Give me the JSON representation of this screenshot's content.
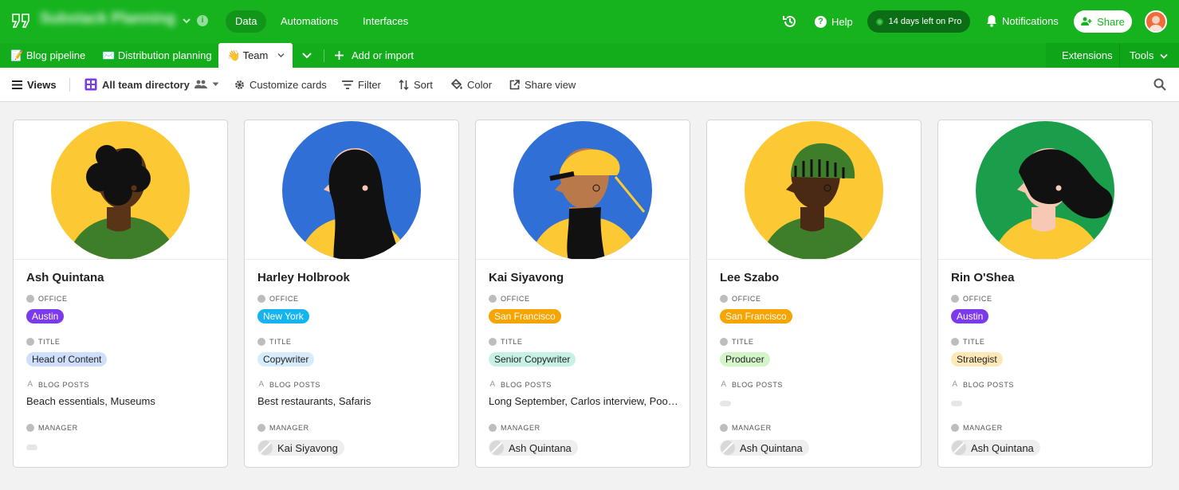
{
  "header": {
    "base_name": "Substack Planning",
    "nav": [
      {
        "label": "Data",
        "active": true
      },
      {
        "label": "Automations",
        "active": false
      },
      {
        "label": "Interfaces",
        "active": false
      }
    ],
    "help_label": "Help",
    "trial_label": "14 days left on Pro",
    "notifications_label": "Notifications",
    "share_label": "Share",
    "colors": {
      "brand": "#16b31f",
      "trial_bg": "#0b6e15"
    }
  },
  "tables": {
    "tabs": [
      {
        "emoji": "📝",
        "label": "Blog pipeline"
      },
      {
        "emoji": "✉️",
        "label": "Distribution planning"
      }
    ],
    "active": {
      "emoji": "👋",
      "label": "Team"
    },
    "add_label": "Add or import",
    "extensions_label": "Extensions",
    "tools_label": "Tools"
  },
  "viewbar": {
    "views_label": "Views",
    "view_name": "All team directory",
    "customize_label": "Customize cards",
    "filter_label": "Filter",
    "sort_label": "Sort",
    "color_label": "Color",
    "share_view_label": "Share view"
  },
  "labels": {
    "office": "OFFICE",
    "title": "TITLE",
    "blog_posts": "BLOG POSTS",
    "manager": "MANAGER"
  },
  "cards": [
    {
      "name": "Ash Quintana",
      "office": "Austin",
      "office_color": "#7c3aed",
      "office_text": "#ffffff",
      "title": "Head of Content",
      "title_color": "#cfdffb",
      "blog_posts": "Beach essentials, Museums",
      "manager": "",
      "avatar": {
        "bg": "#fcc935",
        "skin": "#5a3416",
        "hair": "#111111",
        "shirt": "#3e7d2a"
      }
    },
    {
      "name": "Harley Holbrook",
      "office": "New York",
      "office_color": "#14b4f0",
      "office_text": "#ffffff",
      "title": "Copywriter",
      "title_color": "#d6ecfb",
      "blog_posts": "Best restaurants, Safaris",
      "manager": "Kai Siyavong",
      "avatar": {
        "bg": "#2f6fd6",
        "skin": "#f7c9b4",
        "hair": "#111111",
        "shirt": "#fcc935"
      }
    },
    {
      "name": "Kai Siyavong",
      "office": "San Francisco",
      "office_color": "#f5a400",
      "office_text": "#ffffff",
      "title": "Senior Copywriter",
      "title_color": "#c8f1e6",
      "blog_posts": "Long September, Carlos interview, Poolside Chill",
      "manager": "Ash Quintana",
      "avatar": {
        "bg": "#2f6fd6",
        "skin": "#b9794a",
        "hair": "#111111",
        "shirt": "#fcc935"
      }
    },
    {
      "name": "Lee Szabo",
      "office": "San Francisco",
      "office_color": "#f5a400",
      "office_text": "#ffffff",
      "title": "Producer",
      "title_color": "#d3f5c8",
      "blog_posts": "",
      "manager": "Ash Quintana",
      "avatar": {
        "bg": "#fcc935",
        "skin": "#4a2a14",
        "hair": "#3e7d2a",
        "shirt": "#3e7d2a"
      }
    },
    {
      "name": "Rin O'Shea",
      "office": "Austin",
      "office_color": "#7c3aed",
      "office_text": "#ffffff",
      "title": "Strategist",
      "title_color": "#fde8b8",
      "blog_posts": "",
      "manager": "Ash Quintana",
      "avatar": {
        "bg": "#1a9e4b",
        "skin": "#f7c9b4",
        "hair": "#111111",
        "shirt": "#fcc935"
      }
    }
  ]
}
